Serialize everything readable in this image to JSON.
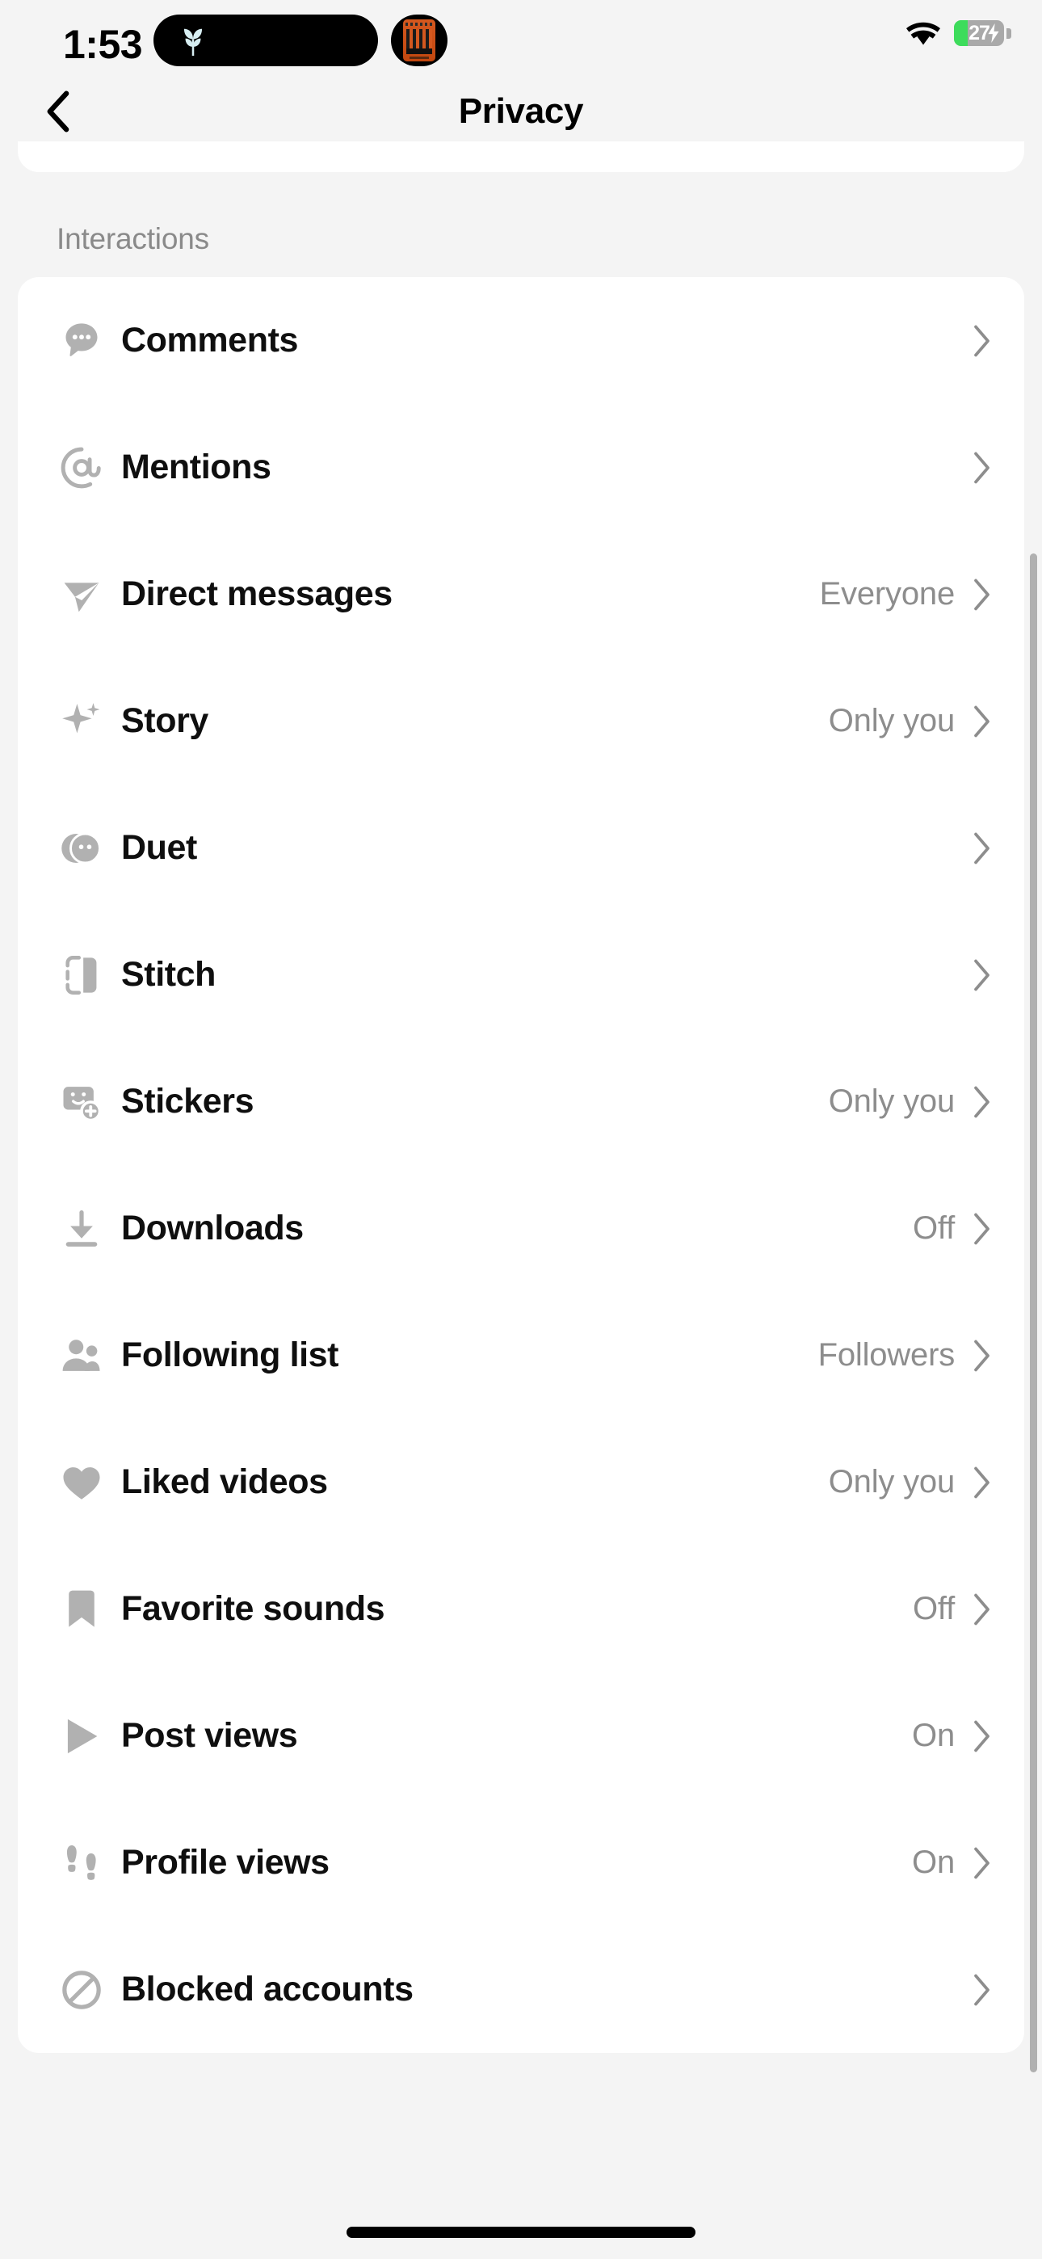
{
  "status_bar": {
    "time": "1:53",
    "battery_percent": "27",
    "battery_level_fraction": 0.27,
    "icons": {
      "dynamic_island_left": "plant-leaf-icon",
      "dynamic_island_right": "album-art-icon",
      "wifi": "wifi-icon",
      "battery": "battery-charging-icon"
    }
  },
  "nav": {
    "back_icon": "chevron-left-icon",
    "title": "Privacy"
  },
  "sections": [
    {
      "label": "Interactions",
      "rows": [
        {
          "icon": "comment-bubble-icon",
          "label": "Comments",
          "value": "",
          "chevron": "chevron-right-icon"
        },
        {
          "icon": "at-mention-icon",
          "label": "Mentions",
          "value": "",
          "chevron": "chevron-right-icon"
        },
        {
          "icon": "paper-plane-icon",
          "label": "Direct messages",
          "value": "Everyone",
          "chevron": "chevron-right-icon"
        },
        {
          "icon": "sparkle-icon",
          "label": "Story",
          "value": "Only you",
          "chevron": "chevron-right-icon"
        },
        {
          "icon": "duet-circles-icon",
          "label": "Duet",
          "value": "",
          "chevron": "chevron-right-icon"
        },
        {
          "icon": "stitch-icon",
          "label": "Stitch",
          "value": "",
          "chevron": "chevron-right-icon"
        },
        {
          "icon": "sticker-plus-icon",
          "label": "Stickers",
          "value": "Only you",
          "chevron": "chevron-right-icon"
        },
        {
          "icon": "download-arrow-icon",
          "label": "Downloads",
          "value": "Off",
          "chevron": "chevron-right-icon"
        },
        {
          "icon": "people-icon",
          "label": "Following list",
          "value": "Followers",
          "chevron": "chevron-right-icon"
        },
        {
          "icon": "heart-icon",
          "label": "Liked videos",
          "value": "Only you",
          "chevron": "chevron-right-icon"
        },
        {
          "icon": "bookmark-icon",
          "label": "Favorite sounds",
          "value": "Off",
          "chevron": "chevron-right-icon"
        },
        {
          "icon": "play-triangle-icon",
          "label": "Post views",
          "value": "On",
          "chevron": "chevron-right-icon"
        },
        {
          "icon": "footprints-icon",
          "label": "Profile views",
          "value": "On",
          "chevron": "chevron-right-icon"
        },
        {
          "icon": "block-circle-slash-icon",
          "label": "Blocked accounts",
          "value": "",
          "chevron": "chevron-right-icon"
        }
      ]
    }
  ],
  "colors": {
    "page_background": "#f4f4f4",
    "card_background": "#ffffff",
    "primary_text": "#0f0f0f",
    "secondary_text": "#8d8d8d",
    "icon_grey": "#b1b1b1",
    "battery_green": "#3ddc5b"
  },
  "home_indicator": "home-indicator"
}
